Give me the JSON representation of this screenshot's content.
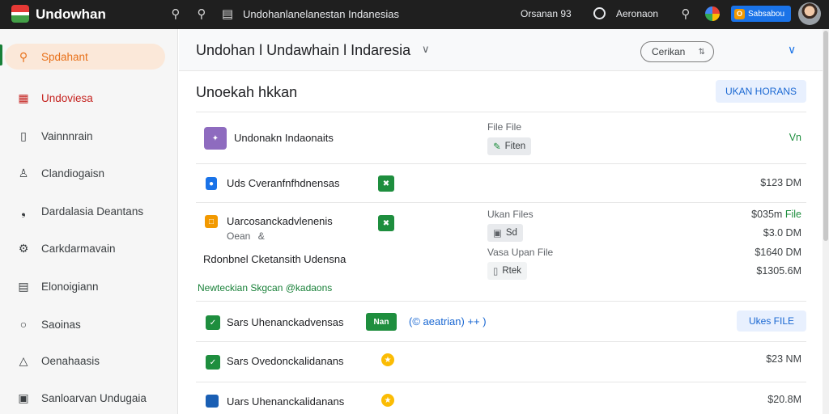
{
  "topbar": {
    "brand": "Undowhan",
    "doc_title": "Undohanlanelanestan Indanesias",
    "status": "Orsanan 93",
    "account": "Aeronaon",
    "badge_letter": "O",
    "badge_label": "Sabsabou"
  },
  "sidebar": {
    "items": [
      {
        "label": "Spdahant",
        "icon": "search-icon"
      },
      {
        "label": "Undoviesa",
        "icon": "grid-icon"
      },
      {
        "label": "Vainnnrain",
        "icon": "door-icon"
      },
      {
        "label": "Clandiogaisn",
        "icon": "person-icon"
      },
      {
        "label": "Dardalasia Deantans",
        "icon": "pin-icon"
      },
      {
        "label": "Carkdarmavain",
        "icon": "gear-icon"
      },
      {
        "label": "Elonoigiann",
        "icon": "document-icon"
      },
      {
        "label": "Saoinas",
        "icon": "location-icon"
      },
      {
        "label": "Oenahaasis",
        "icon": "bell-icon"
      },
      {
        "label": "Sanloarvan Undugaia",
        "icon": "trash-icon"
      }
    ]
  },
  "main": {
    "title": "Undohan l Undawhain l Indaresia",
    "filter_label": "Cerikan",
    "section_title": "Unoekah hkkan",
    "section_button": "UKAN HORANS"
  },
  "rows": {
    "r1": {
      "title": "Undonakn Indaonaits",
      "file_label": "File File",
      "chip": "Fiten",
      "status": "Vn"
    },
    "r2": {
      "title": "Uds Cveranfnfhdnensas",
      "price": "$123 DM"
    },
    "r3": {
      "title": "Uarcosanckadvlenenis",
      "subtitle": "Oean",
      "subtitle_icon": "&",
      "label_files": "Ukan Files",
      "chip1": "Sd",
      "label_file2": "Vasa Upan File",
      "chip2": "Rtek",
      "price1": "$035m",
      "price1_suffix": "File",
      "price2": "$3.0 DM",
      "price3": "$1640 DM",
      "price4": "$1305.6M",
      "extra_line": "Rdonbnel Cketansith Udensna",
      "link": "Newteckian Skgcan  @kadaons"
    },
    "r4": {
      "title": "Sars Uhenanckadvensas",
      "tag": "Nan",
      "action": "(© aeatrian) ++ )",
      "button": "Ukes FILE"
    },
    "r5": {
      "title": "Sars Ovedonckalidanans",
      "price": "$23 NM"
    },
    "r6": {
      "title": "Uars Uhenanckalidanans",
      "price": "$20.8M"
    }
  },
  "colors": {
    "accent_orange": "#e8711a",
    "active_red": "#c5221f",
    "green": "#1e8e3e",
    "blue": "#1a73e8"
  }
}
